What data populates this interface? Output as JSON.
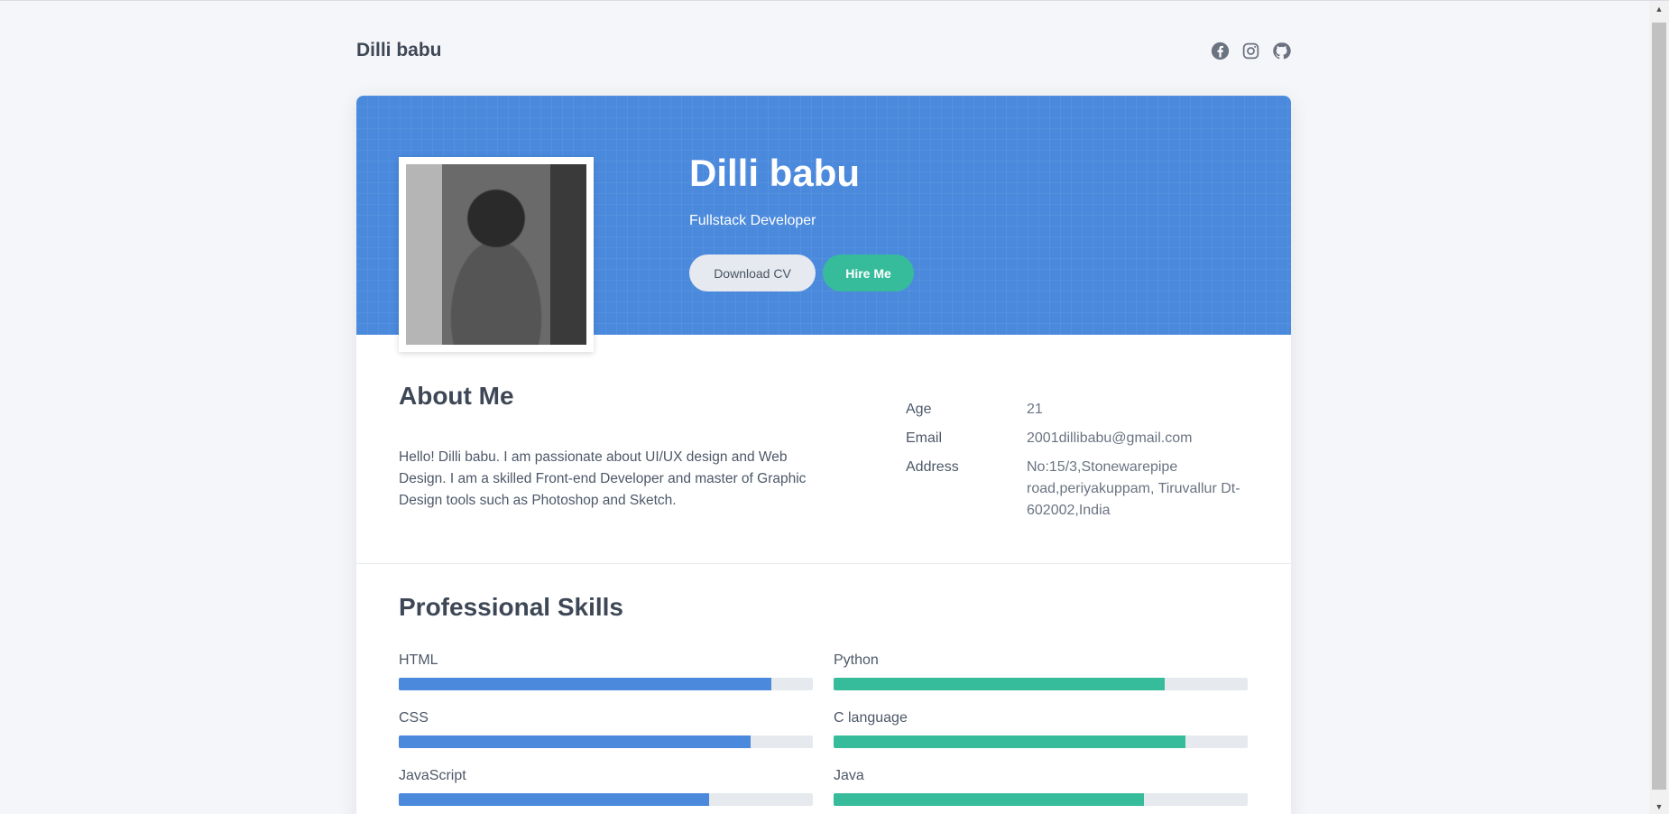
{
  "header": {
    "brand": "Dilli babu",
    "social_icons": [
      "facebook-icon",
      "instagram-icon",
      "github-icon"
    ]
  },
  "hero": {
    "name": "Dilli babu",
    "title": "Fullstack Developer",
    "download_label": "Download CV",
    "hire_label": "Hire Me"
  },
  "about": {
    "heading": "About Me",
    "text": "Hello! Dilli babu. I am passionate about UI/UX design and Web Design. I am a skilled Front-end Developer and master of Graphic Design tools such as Photoshop and Sketch.",
    "info": [
      {
        "key": "Age",
        "value": "21"
      },
      {
        "key": "Email",
        "value": "2001dillibabu@gmail.com"
      },
      {
        "key": "Address",
        "value": "No:15/3,Stonewarepipe road,periyakuppam, Tiruvallur Dt-602002,India"
      }
    ]
  },
  "skills": {
    "heading": "Professional Skills",
    "left": [
      {
        "label": "HTML",
        "percent": 90
      },
      {
        "label": "CSS",
        "percent": 85
      },
      {
        "label": "JavaScript",
        "percent": 75
      }
    ],
    "right": [
      {
        "label": "Python",
        "percent": 80
      },
      {
        "label": "C language",
        "percent": 85
      },
      {
        "label": "Java",
        "percent": 75
      }
    ]
  },
  "colors": {
    "primary": "#4a89dc",
    "accent": "#37bc9b",
    "text": "#3e4756"
  }
}
